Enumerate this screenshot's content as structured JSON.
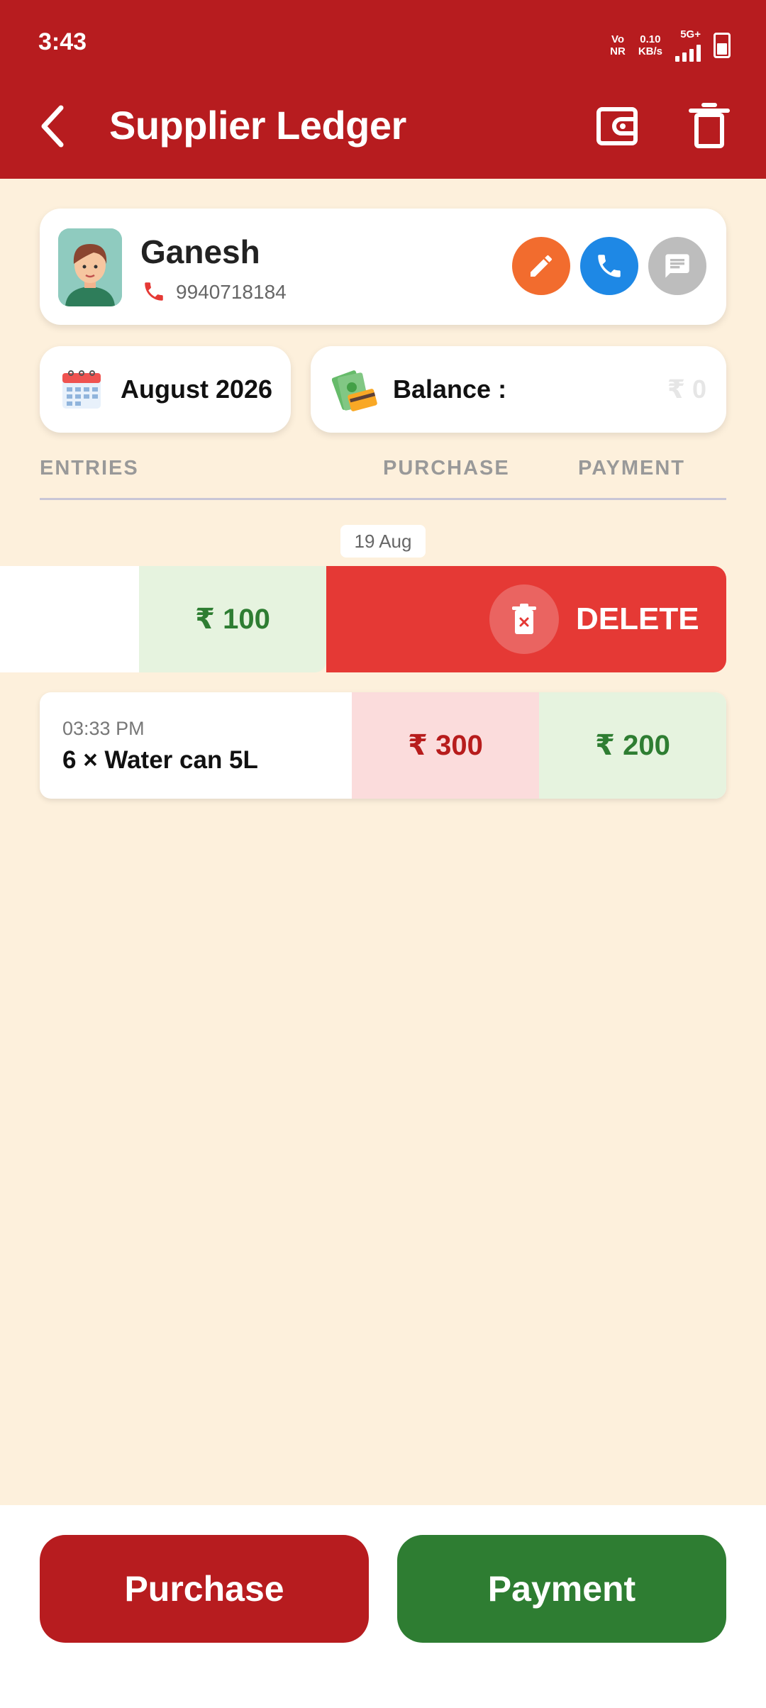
{
  "status_bar": {
    "time": "3:43",
    "network_top": "Vo",
    "network_bottom": "NR",
    "speed_top": "0.10",
    "speed_bottom": "KB/s",
    "signal_label": "5G+"
  },
  "header": {
    "title": "Supplier Ledger",
    "back_icon": "back-arrow-icon",
    "wallet_icon": "wallet-icon",
    "delete_icon": "trash-icon"
  },
  "contact": {
    "name": "Ganesh",
    "phone": "9940718184",
    "actions": [
      "edit-icon",
      "call-icon",
      "message-icon"
    ]
  },
  "period": {
    "month": "August 2026"
  },
  "balance": {
    "label": "Balance :",
    "value": "₹ 0"
  },
  "columns": {
    "entries": "ENTRIES",
    "purchase": "PURCHASE",
    "payment": "PAYMENT"
  },
  "date_group": "19 Aug",
  "swiped_entry": {
    "payment": "₹ 100",
    "delete_label": "DELETE"
  },
  "entries": [
    {
      "time": "03:33 PM",
      "description": "6 × Water can 5L",
      "purchase": "₹ 300",
      "payment": "₹ 200"
    }
  ],
  "footer": {
    "purchase_label": "Purchase",
    "payment_label": "Payment"
  },
  "colors": {
    "primary_red": "#b71c1f",
    "primary_green": "#2e7d32",
    "background": "#fdf0dc",
    "delete_red": "#e53935"
  }
}
